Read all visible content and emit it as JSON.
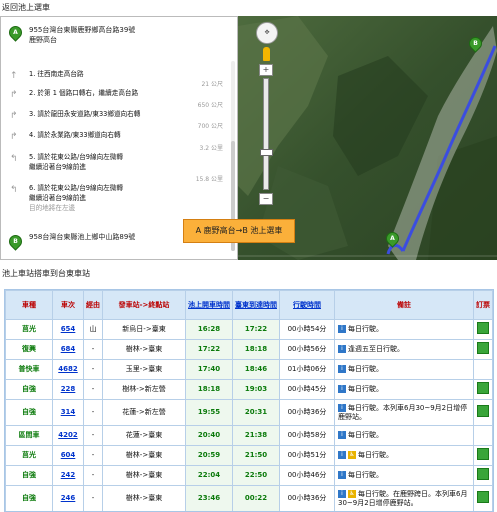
{
  "back_link": "返回池上選車",
  "directions": {
    "start": {
      "marker": "A",
      "address": "955台灣台東縣鹿野鄉高台路39號",
      "place": "鹿野高台"
    },
    "steps": [
      {
        "num": "1.",
        "text": "往西南走高台路",
        "dist": "21 公尺",
        "icon": "up-arrow-icon"
      },
      {
        "num": "2.",
        "text": "於第 1 個路口轉右，繼續走高台路",
        "dist": "650 公尺",
        "icon": "turn-right-icon"
      },
      {
        "num": "3.",
        "text": "請於龍田永安道路/東33鄉道向右轉",
        "dist": "700 公尺",
        "icon": "turn-right-icon"
      },
      {
        "num": "4.",
        "text": "請於永業路/東33鄉道向右轉",
        "dist": "3.2 公里",
        "icon": "turn-right-icon"
      },
      {
        "num": "5.",
        "text": "請於花東公路/台9線向左微轉",
        "sub": "繼續沿著台9線前進",
        "dist": "15.8 公里",
        "icon": "slight-left-icon"
      },
      {
        "num": "6.",
        "text": "請於花東公路/台9線向左微轉",
        "sub": "繼續沿著台9線前進",
        "note": "目的地將在左邊",
        "dist": "",
        "icon": "slight-left-icon"
      }
    ],
    "end": {
      "marker": "B",
      "address": "958台灣台東縣池上鄉中山路89號"
    }
  },
  "map": {
    "route_button": "A 鹿野高台→B 池上選車",
    "zoom_in": "+",
    "zoom_out": "−",
    "labels": {
      "a": "A",
      "b": "B"
    }
  },
  "section_title": "池上車站搭車到台東車站",
  "table": {
    "headers": {
      "type": "車種",
      "train": "車次",
      "via": "經由",
      "route": "發車站->終點站",
      "dep": "池上開車時間",
      "arr": "臺東到達時間",
      "dur": "行駛時間",
      "note": "備註",
      "ticket": "訂票"
    },
    "rows": [
      {
        "type": "莒光",
        "train": "654",
        "via": "山",
        "route": "新烏日->臺東",
        "dep": "16:28",
        "arr": "17:22",
        "dur": "00小時54分",
        "note": "每日行駛。",
        "wheelchair": false,
        "ticket": true
      },
      {
        "type": "復興",
        "train": "684",
        "via": "-",
        "route": "樹林->臺東",
        "dep": "17:22",
        "arr": "18:18",
        "dur": "00小時56分",
        "note": "逢週五至日行駛。",
        "wheelchair": false,
        "ticket": true
      },
      {
        "type": "普快車",
        "train": "4682",
        "via": "-",
        "route": "玉里->臺東",
        "dep": "17:40",
        "arr": "18:46",
        "dur": "01小時06分",
        "note": "每日行駛。",
        "wheelchair": false,
        "ticket": false
      },
      {
        "type": "自強",
        "train": "228",
        "via": "-",
        "route": "樹林->新左營",
        "dep": "18:18",
        "arr": "19:03",
        "dur": "00小時45分",
        "note": "每日行駛。",
        "wheelchair": false,
        "ticket": true
      },
      {
        "type": "自強",
        "train": "314",
        "via": "-",
        "route": "花蓮->新左營",
        "dep": "19:55",
        "arr": "20:31",
        "dur": "00小時36分",
        "note": "每日行駛。本列車6月30~9月2日增停鹿野站。",
        "wheelchair": false,
        "ticket": true
      },
      {
        "type": "區間車",
        "train": "4202",
        "via": "-",
        "route": "花蓮->臺東",
        "dep": "20:40",
        "arr": "21:38",
        "dur": "00小時58分",
        "note": "每日行駛。",
        "wheelchair": false,
        "ticket": false
      },
      {
        "type": "莒光",
        "train": "604",
        "via": "-",
        "route": "樹林->臺東",
        "dep": "20:59",
        "arr": "21:50",
        "dur": "00小時51分",
        "note": "每日行駛。",
        "wheelchair": true,
        "ticket": true
      },
      {
        "type": "自強",
        "train": "242",
        "via": "-",
        "route": "樹林->臺東",
        "dep": "22:04",
        "arr": "22:50",
        "dur": "00小時46分",
        "note": "每日行駛。",
        "wheelchair": false,
        "ticket": true
      },
      {
        "type": "自強",
        "train": "246",
        "via": "-",
        "route": "樹林->臺東",
        "dep": "23:46",
        "arr": "00:22",
        "dur": "00小時36分",
        "note": "每日行駛。在鹿野跨日。本列車6月30~9月2日增停鹿野站。",
        "wheelchair": true,
        "ticket": true
      }
    ]
  }
}
